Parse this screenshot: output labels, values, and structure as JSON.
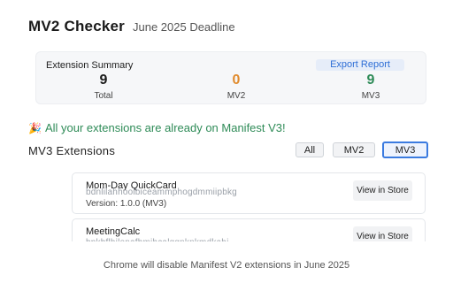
{
  "header": {
    "title": "MV2 Checker",
    "subtitle": "June 2025 Deadline"
  },
  "summary": {
    "heading": "Extension Summary",
    "export_label": "Export Report",
    "stats": [
      {
        "value": "9",
        "label": "Total",
        "color": "#1a1a1a"
      },
      {
        "value": "0",
        "label": "MV2",
        "color": "#e08a2c"
      },
      {
        "value": "9",
        "label": "MV3",
        "color": "#2e8b57"
      }
    ]
  },
  "status": {
    "icon": "party-popper-icon",
    "message": "All your extensions are already on Manifest V3!"
  },
  "section": {
    "title": "MV3 Extensions",
    "filters": [
      "All",
      "MV2",
      "MV3"
    ],
    "active_filter": "MV3"
  },
  "extensions": [
    {
      "name": "Mom-Day QuickCard",
      "id": "bdnlilahhoolbiceammphogdmmiipbkg",
      "version": "Version: 1.0.0 (MV3)",
      "store_label": "View in Store"
    },
    {
      "name": "MeetingCalc",
      "id": "bpkbflhjlonafhmihcalggnknkmdkahj",
      "version": "",
      "store_label": "View in Store"
    }
  ],
  "footer": {
    "text": "Chrome will disable Manifest V2 extensions in June 2025"
  },
  "colors": {
    "accent": "#3b7be0",
    "success": "#2e8b57",
    "warning": "#e08a2c"
  }
}
